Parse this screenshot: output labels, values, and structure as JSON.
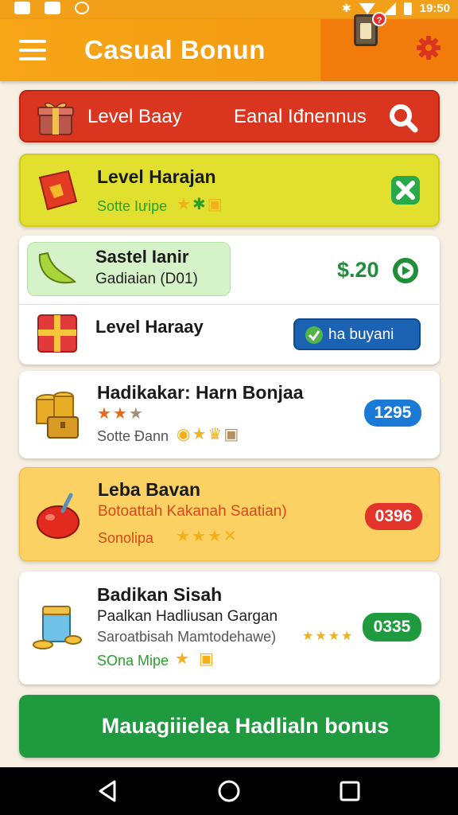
{
  "status_bar": {
    "time": "19:50"
  },
  "app_bar": {
    "title": "Casual Bonun",
    "notification_count": "?"
  },
  "banner": {
    "left_label": "Level Baay",
    "right_label": "Eanal Iđnennus"
  },
  "card_level_harajan": {
    "title": "Level Harajan",
    "meta": "Sotte Iưipe"
  },
  "card_sastel": {
    "title": "Sastel Ianir",
    "subtitle": "Gadiaian (D01)",
    "price": "$.20",
    "row2_title": "Level Haraay",
    "row2_button": "ha buyani"
  },
  "card_hadikakar": {
    "title": "Hadikakar: Harn Bonjaa",
    "meta": "Sotte Đann",
    "badge": "1295"
  },
  "card_leba": {
    "title": "Leba Bavan",
    "subtitle": "Botoattah Kakanah Saatian)",
    "meta": "Sonolipa",
    "badge": "0396"
  },
  "card_badikan": {
    "title": "Badikan Sisah",
    "line2": "Paalkan Hadliusan Gargan",
    "line3": "Saroatbisah Mamtodehawe)",
    "meta": "SOna Mipe",
    "badge": "0335"
  },
  "cta": {
    "label": "Mauagiiielea Hadlialn bonus"
  },
  "colors": {
    "app_bar": "#f49b12",
    "banner": "#d9351f",
    "yellow_card": "#e1e02e",
    "orange_card": "#fcd164",
    "cta": "#1f9a3f",
    "blue_badge": "#1a7ad6",
    "red_badge": "#e2342a",
    "green_badge": "#1f9a3f"
  }
}
